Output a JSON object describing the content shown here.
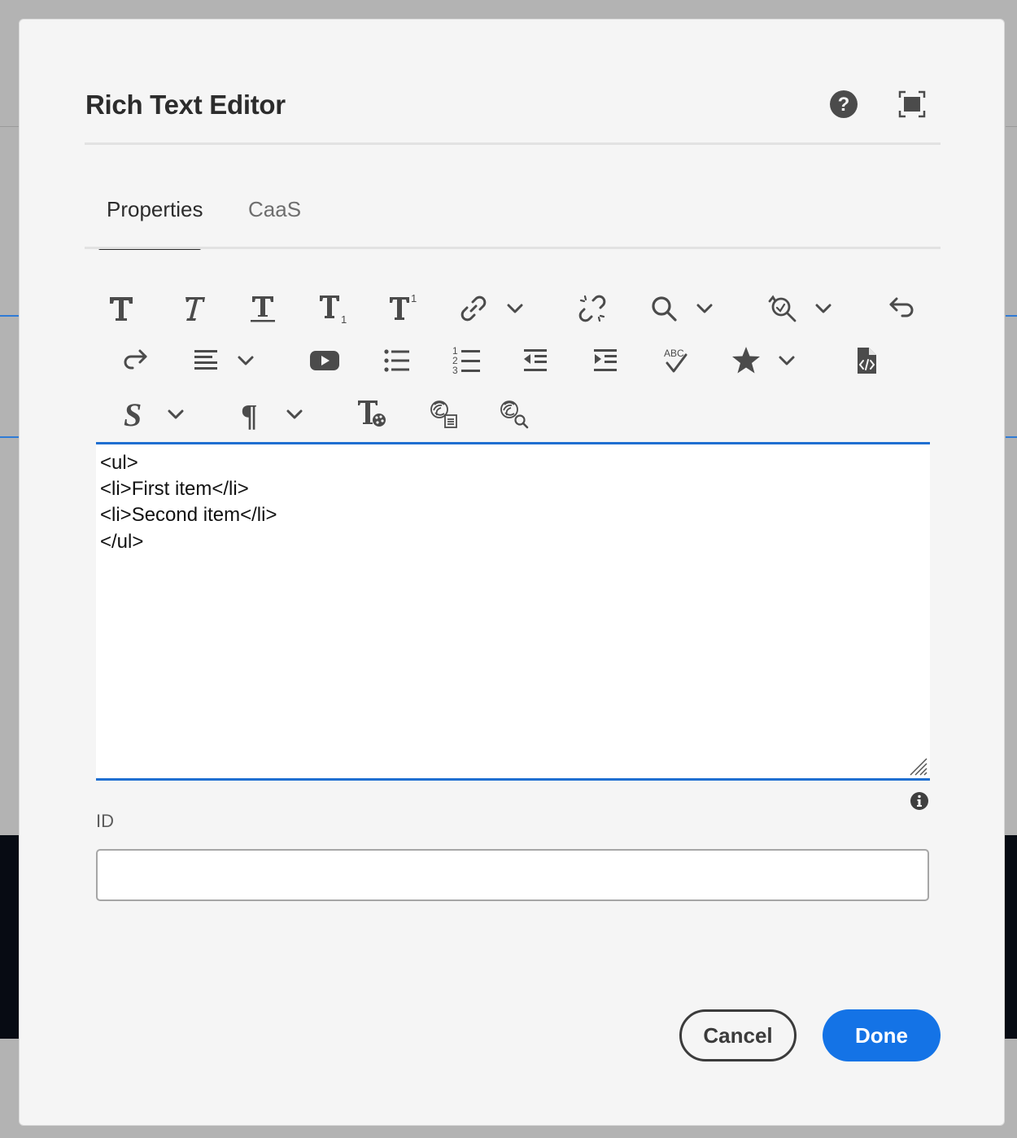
{
  "dialog": {
    "title": "Rich Text Editor",
    "header_icons": [
      "help-icon",
      "fullscreen-icon"
    ]
  },
  "tabs": [
    {
      "label": "Properties",
      "active": true
    },
    {
      "label": "CaaS",
      "active": false
    }
  ],
  "toolbar": {
    "row1": [
      "bold-icon",
      "italic-icon",
      "underline-icon",
      "subscript-icon",
      "superscript-icon",
      "link-icon",
      "unlink-icon",
      "find-icon",
      "find-replace-icon",
      "undo-icon"
    ],
    "row2": [
      "redo-icon",
      "justify-icon",
      "youtube-icon",
      "bullet-list-icon",
      "numbered-list-icon",
      "outdent-icon",
      "indent-icon",
      "spellcheck-icon",
      "special-chars-icon",
      "source-edit-icon"
    ],
    "row3": [
      "styles-icon",
      "paragraph-format-icon",
      "text-style-icon",
      "ai-generate-icon",
      "ai-search-icon"
    ],
    "subscript_digit": "1",
    "superscript_digit": "1",
    "spellcheck_text": "ABC",
    "numbered_digits": [
      "1",
      "2",
      "3"
    ],
    "styles_glyph": "S",
    "paragraph_glyph": "¶"
  },
  "editor": {
    "lines": [
      "<ul>",
      "<li>First item</li>",
      "<li>Second item</li>",
      "</ul>"
    ]
  },
  "id_field": {
    "label": "ID",
    "value": "",
    "placeholder": ""
  },
  "buttons": {
    "cancel": "Cancel",
    "done": "Done"
  },
  "colors": {
    "accent": "#1473e6",
    "icon": "#4b4b4b",
    "dialog_bg": "#f5f5f5"
  }
}
